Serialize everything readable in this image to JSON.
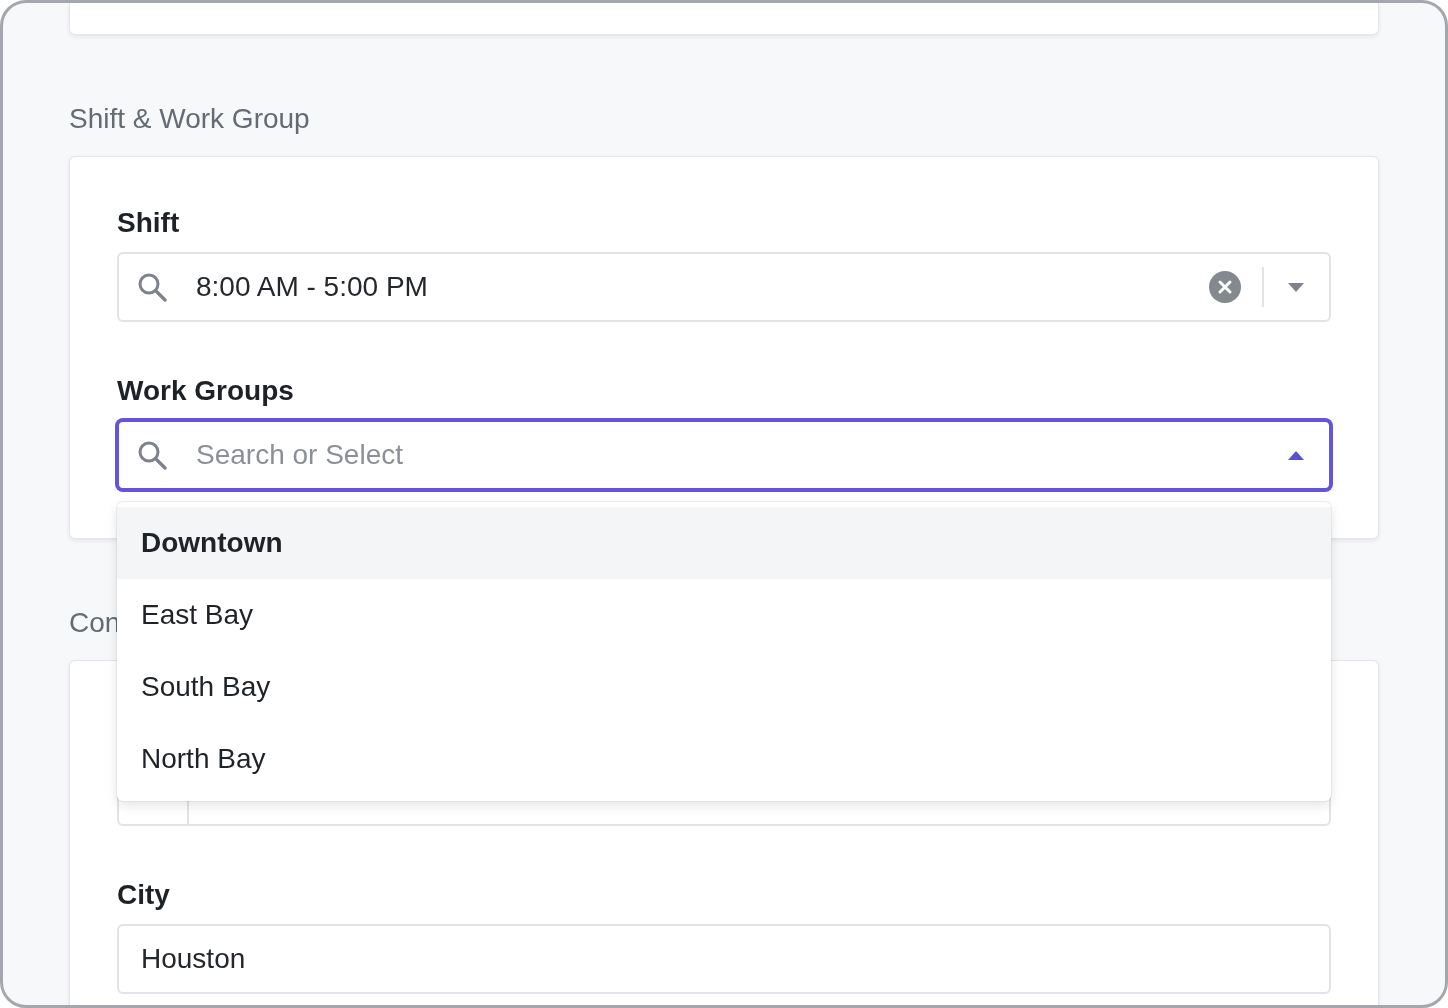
{
  "sections": [
    {
      "title": "Shift & Work Group",
      "fields": [
        {
          "kind": "select",
          "label": "Shift",
          "value": "8:00 AM - 5:00 PM",
          "open": false
        },
        {
          "kind": "select",
          "label": "Work Groups",
          "placeholder": "Search or Select",
          "open": true,
          "options": [
            {
              "label": "Downtown",
              "selected": true
            },
            {
              "label": "East Bay",
              "selected": false
            },
            {
              "label": "South Bay",
              "selected": false
            },
            {
              "label": "North Bay",
              "selected": false
            }
          ]
        }
      ]
    },
    {
      "title": "Con",
      "fields": [
        {
          "kind": "phone"
        },
        {
          "kind": "text",
          "label": "City",
          "value": "Houston"
        }
      ]
    }
  ]
}
